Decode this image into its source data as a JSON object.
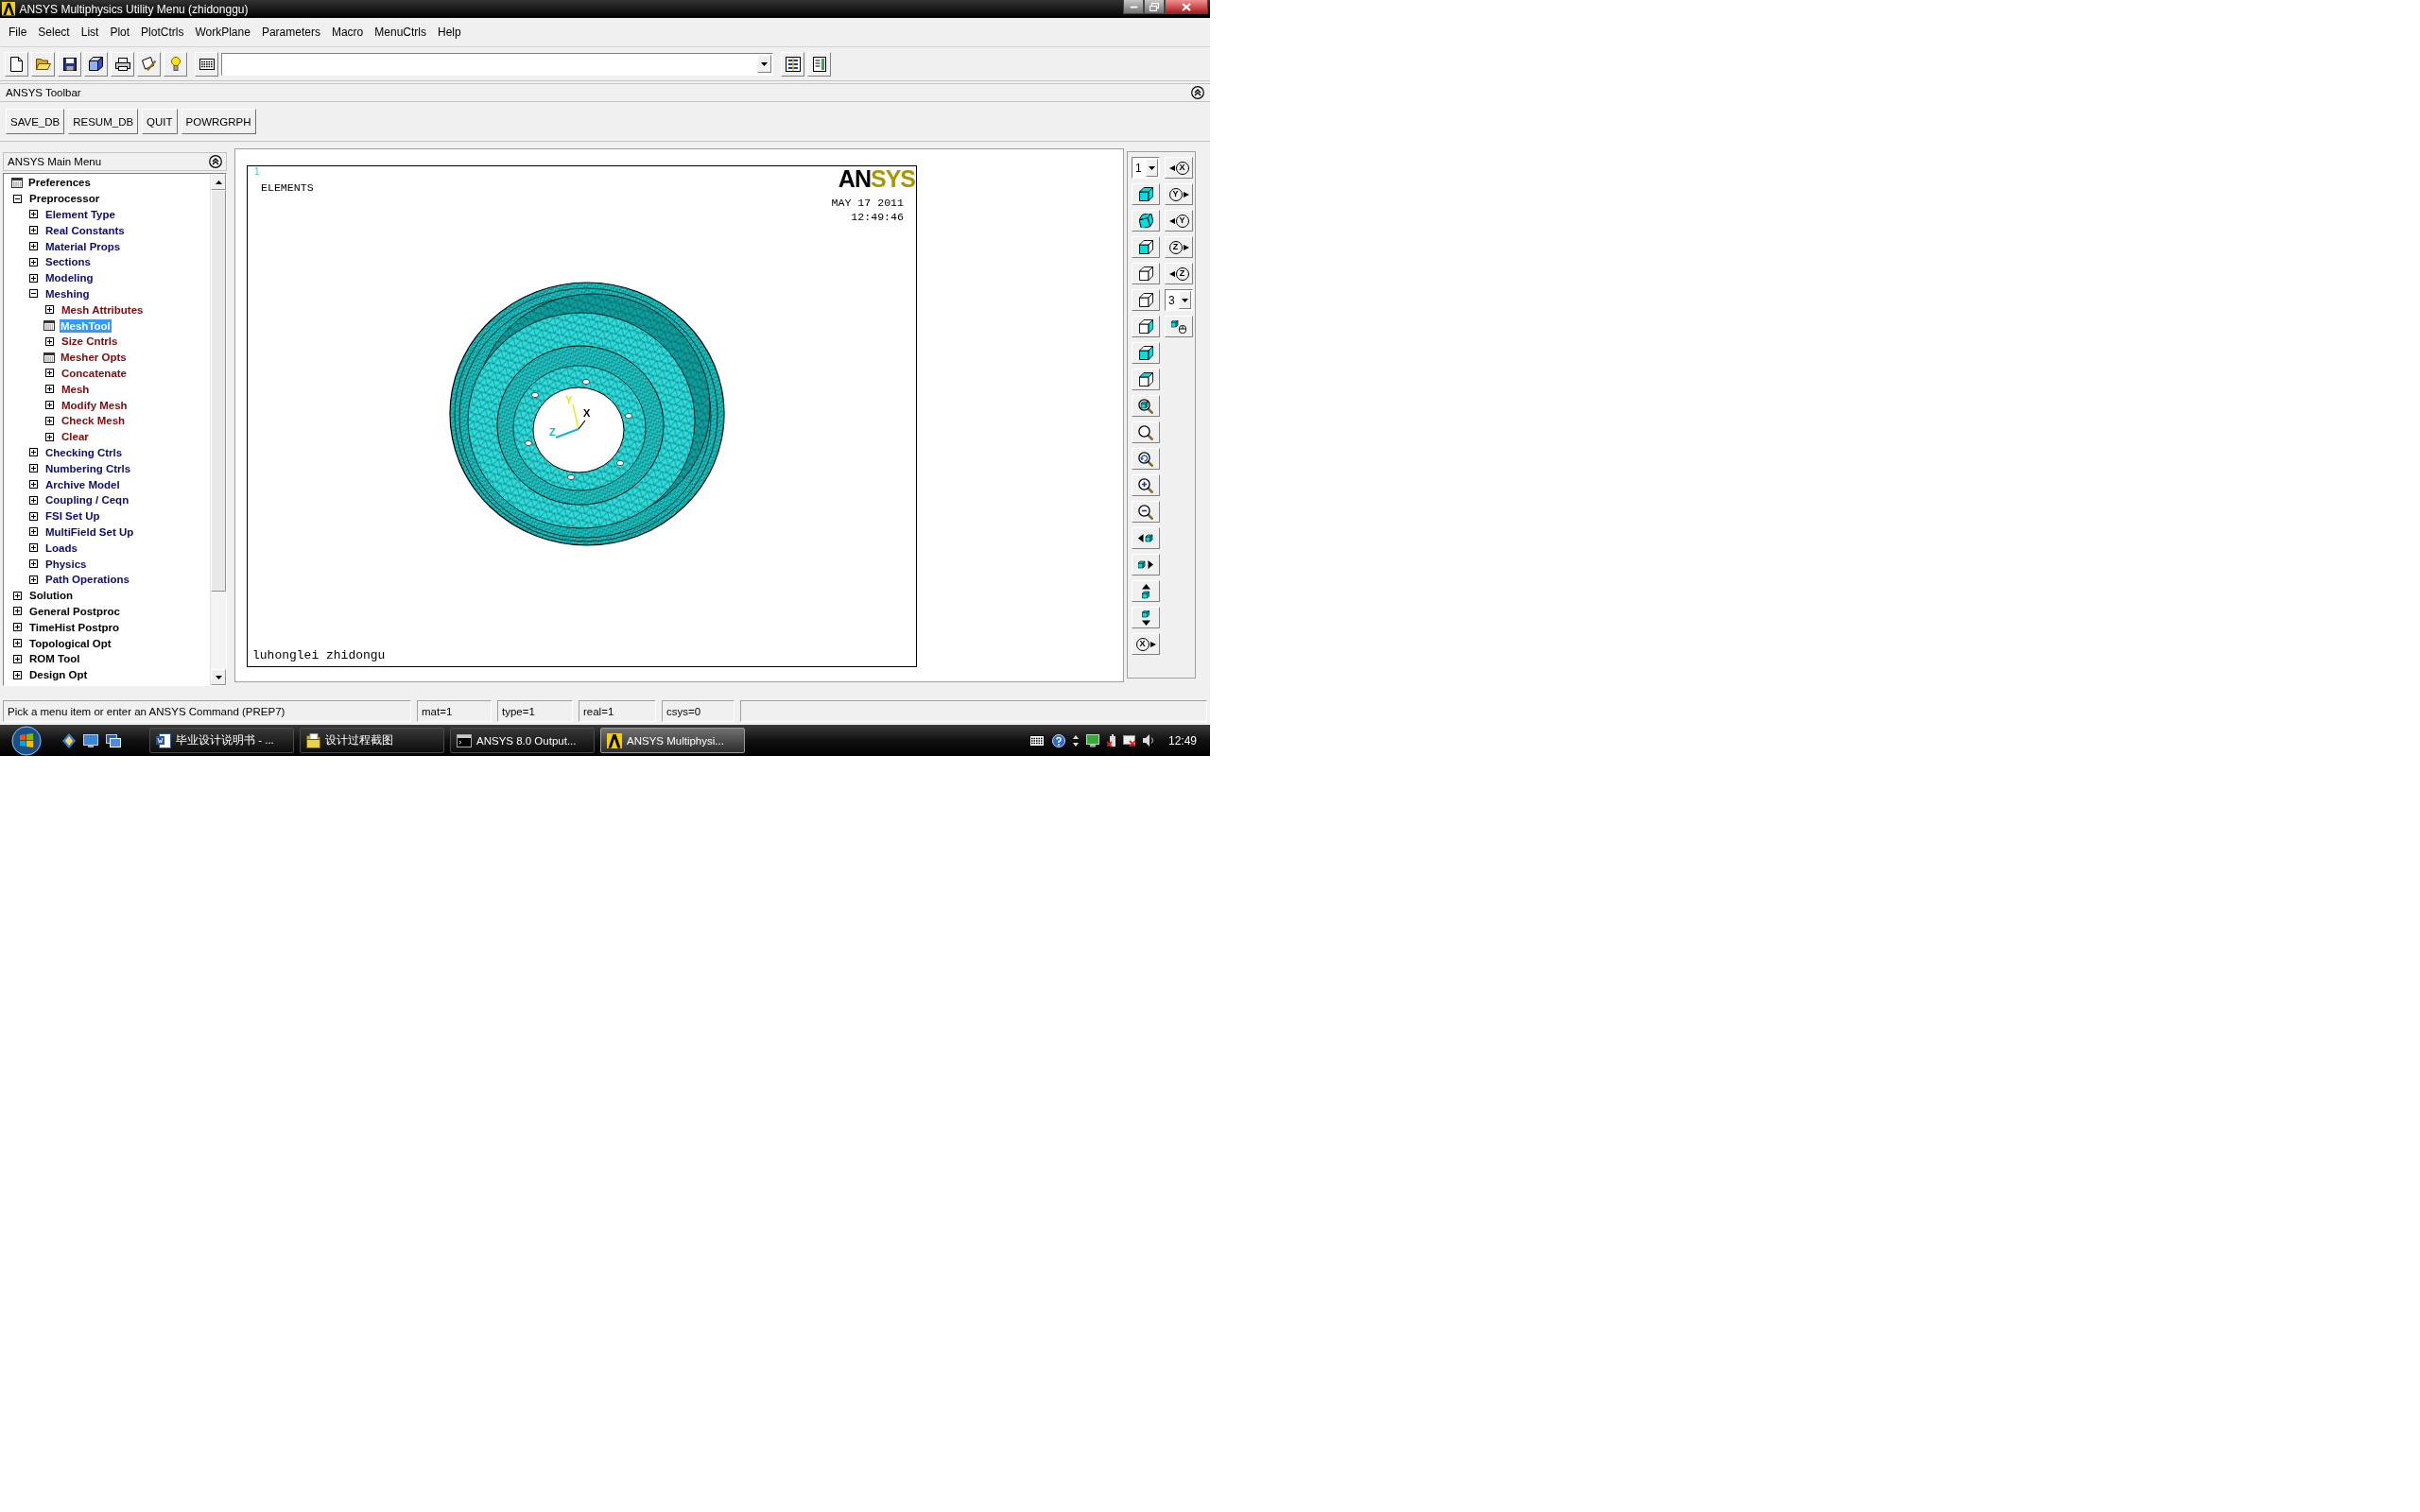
{
  "window": {
    "title": "ANSYS Multiphysics Utility Menu (zhidonggu)"
  },
  "menu_bar": [
    "File",
    "Select",
    "List",
    "Plot",
    "PlotCtrls",
    "WorkPlane",
    "Parameters",
    "Macro",
    "MenuCtrls",
    "Help"
  ],
  "ansys_toolbar": {
    "title": "ANSYS Toolbar",
    "buttons": [
      "SAVE_DB",
      "RESUM_DB",
      "QUIT",
      "POWRGRPH"
    ]
  },
  "main_menu": {
    "title": "ANSYS Main Menu",
    "items": [
      {
        "label": "Preferences",
        "kind": "dialog",
        "selected": false
      },
      {
        "label": "Preprocessor",
        "kind": "folder",
        "expanded": true,
        "selected": false,
        "children": [
          {
            "label": "Element Type",
            "kind": "folder",
            "expanded": false,
            "selected": false
          },
          {
            "label": "Real Constants",
            "kind": "folder",
            "expanded": false,
            "selected": false
          },
          {
            "label": "Material Props",
            "kind": "folder",
            "expanded": false,
            "selected": false
          },
          {
            "label": "Sections",
            "kind": "folder",
            "expanded": false,
            "selected": false
          },
          {
            "label": "Modeling",
            "kind": "folder",
            "expanded": false,
            "selected": false
          },
          {
            "label": "Meshing",
            "kind": "folder",
            "expanded": true,
            "selected": false,
            "children": [
              {
                "label": "Mesh Attributes",
                "kind": "folder",
                "expanded": false,
                "selected": false
              },
              {
                "label": "MeshTool",
                "kind": "dialog",
                "selected": true
              },
              {
                "label": "Size Cntrls",
                "kind": "folder",
                "expanded": false,
                "selected": false
              },
              {
                "label": "Mesher Opts",
                "kind": "dialog",
                "selected": false
              },
              {
                "label": "Concatenate",
                "kind": "folder",
                "expanded": false,
                "selected": false
              },
              {
                "label": "Mesh",
                "kind": "folder",
                "expanded": false,
                "selected": false
              },
              {
                "label": "Modify Mesh",
                "kind": "folder",
                "expanded": false,
                "selected": false
              },
              {
                "label": "Check Mesh",
                "kind": "folder",
                "expanded": false,
                "selected": false
              },
              {
                "label": "Clear",
                "kind": "folder",
                "expanded": false,
                "selected": false
              }
            ]
          },
          {
            "label": "Checking Ctrls",
            "kind": "folder",
            "expanded": false,
            "selected": false
          },
          {
            "label": "Numbering Ctrls",
            "kind": "folder",
            "expanded": false,
            "selected": false
          },
          {
            "label": "Archive Model",
            "kind": "folder",
            "expanded": false,
            "selected": false
          },
          {
            "label": "Coupling / Ceqn",
            "kind": "folder",
            "expanded": false,
            "selected": false
          },
          {
            "label": "FSI Set Up",
            "kind": "folder",
            "expanded": false,
            "selected": false
          },
          {
            "label": "MultiField Set Up",
            "kind": "folder",
            "expanded": false,
            "selected": false
          },
          {
            "label": "Loads",
            "kind": "folder",
            "expanded": false,
            "selected": false
          },
          {
            "label": "Physics",
            "kind": "folder",
            "expanded": false,
            "selected": false
          },
          {
            "label": "Path Operations",
            "kind": "folder",
            "expanded": false,
            "selected": false
          }
        ]
      },
      {
        "label": "Solution",
        "kind": "folder",
        "expanded": false,
        "selected": false
      },
      {
        "label": "General Postproc",
        "kind": "folder",
        "expanded": false,
        "selected": false
      },
      {
        "label": "TimeHist Postpro",
        "kind": "folder",
        "expanded": false,
        "selected": false
      },
      {
        "label": "Topological Opt",
        "kind": "folder",
        "expanded": false,
        "selected": false
      },
      {
        "label": "ROM Tool",
        "kind": "folder",
        "expanded": false,
        "selected": false
      },
      {
        "label": "Design Opt",
        "kind": "folder",
        "expanded": false,
        "selected": false
      }
    ]
  },
  "graphics": {
    "window_number": "1",
    "label": "ELEMENTS",
    "logo": [
      "AN",
      "SYS"
    ],
    "date": "MAY 17 2011",
    "time": "12:49:46",
    "title": "luhonglei zhidongu",
    "triad": [
      {
        "label": "Y",
        "color": "#e6e600"
      },
      {
        "label": "X",
        "color": "#000000"
      },
      {
        "label": "Z",
        "color": "#19b4c8"
      }
    ]
  },
  "view_toolbar": {
    "dropdowns": [
      "1",
      "3"
    ],
    "rotate_buttons": [
      "X",
      "Y",
      "Y",
      "Z",
      "Z",
      "X"
    ]
  },
  "status_bar": [
    "Pick a menu item or enter an ANSYS Command (PREP7)",
    "mat=1",
    "type=1",
    "real=1",
    "csys=0"
  ],
  "taskbar": {
    "tasks": [
      {
        "label": "毕业设计说明书 - ...",
        "kind": "document",
        "selected": false
      },
      {
        "label": "设计过程截图",
        "kind": "folder",
        "selected": false
      },
      {
        "label": "ANSYS 8.0 Output...",
        "kind": "console",
        "selected": false
      },
      {
        "label": "ANSYS Multiphysi...",
        "kind": "app",
        "selected": true
      }
    ],
    "clock": "12:49"
  }
}
